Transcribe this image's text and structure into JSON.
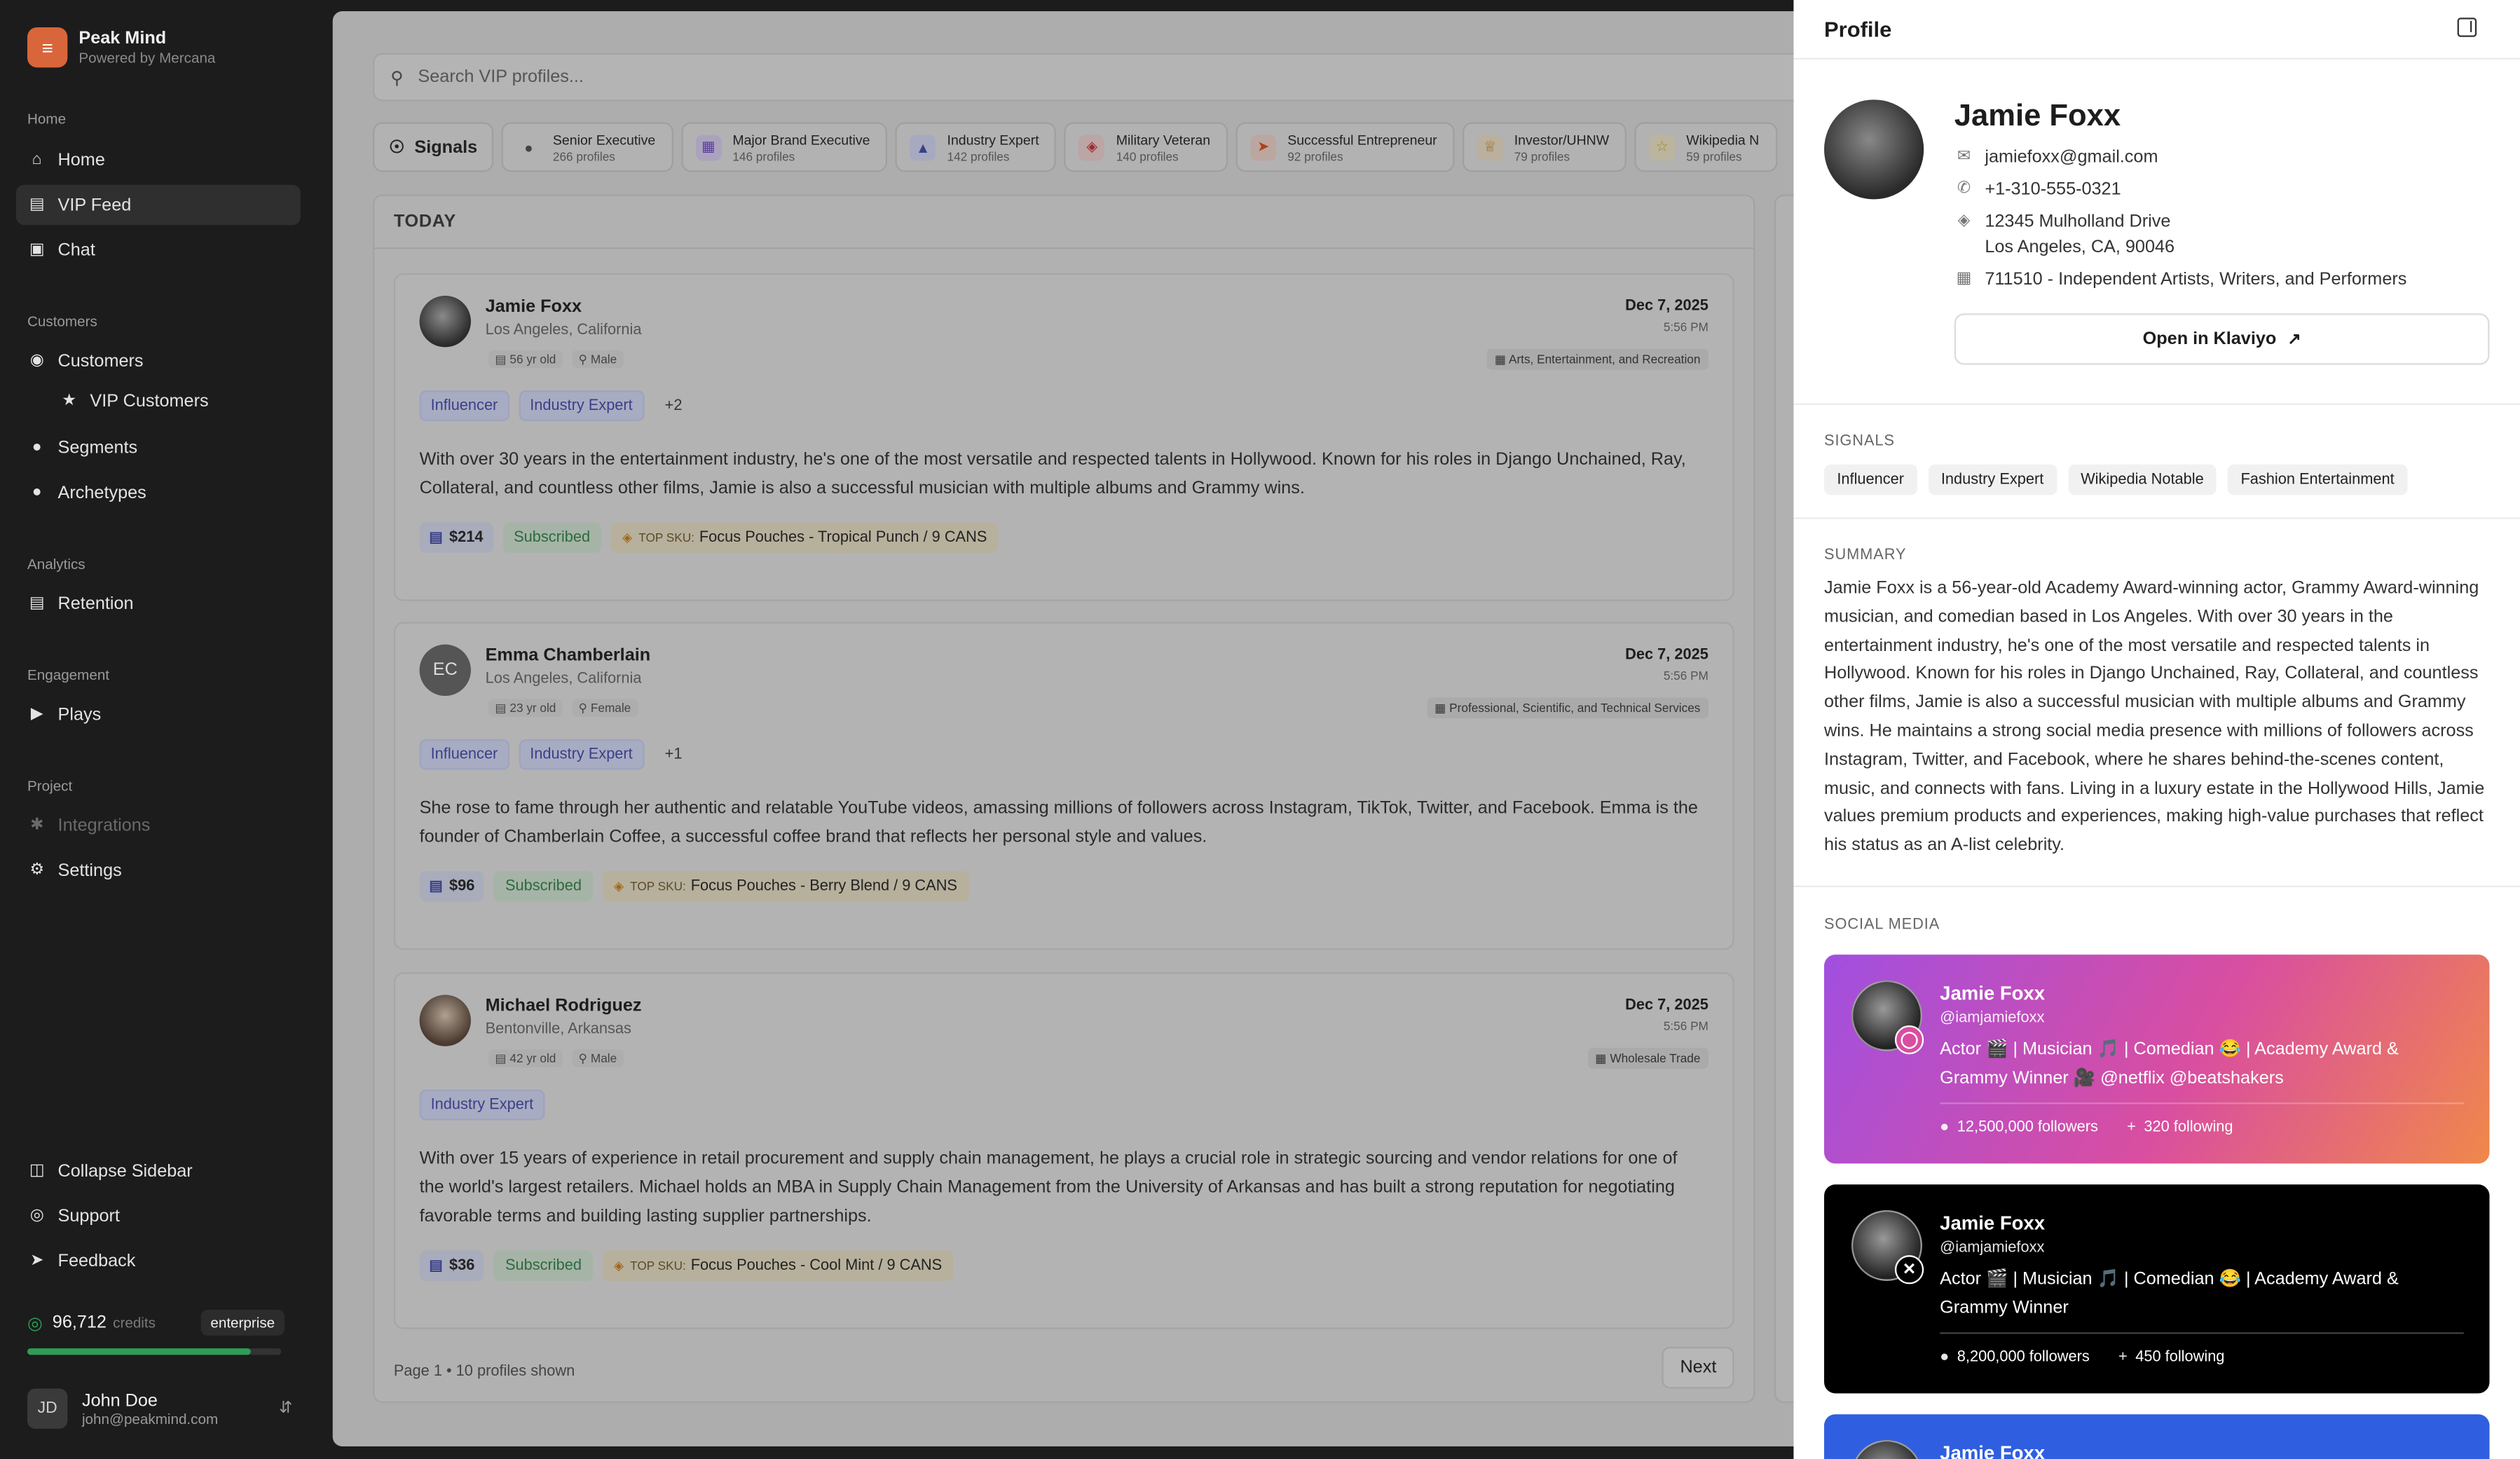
{
  "brand": {
    "name": "Peak Mind",
    "sub": "Powered by Mercana"
  },
  "nav": {
    "home_section": "Home",
    "home": "Home",
    "vip_feed": "VIP Feed",
    "chat": "Chat",
    "customers_section": "Customers",
    "customers": "Customers",
    "vip_customers": "VIP Customers",
    "segments": "Segments",
    "archetypes": "Archetypes",
    "analytics_section": "Analytics",
    "retention": "Retention",
    "engagement_section": "Engagement",
    "plays": "Plays",
    "project_section": "Project",
    "integrations": "Integrations",
    "settings": "Settings",
    "collapse": "Collapse Sidebar",
    "support": "Support",
    "feedback": "Feedback"
  },
  "credits": {
    "value": "96,712",
    "label": "credits",
    "plan": "enterprise",
    "fill_fraction": 0.88
  },
  "user": {
    "initials": "JD",
    "name": "John Doe",
    "email": "john@peakmind.com"
  },
  "search": {
    "placeholder": "Search VIP profiles..."
  },
  "signals_label": "Signals",
  "chips": [
    {
      "title": "Senior Executive",
      "sub": "266 profiles"
    },
    {
      "title": "Major Brand Executive",
      "sub": "146 profiles"
    },
    {
      "title": "Industry Expert",
      "sub": "142 profiles"
    },
    {
      "title": "Military Veteran",
      "sub": "140 profiles"
    },
    {
      "title": "Successful Entrepreneur",
      "sub": "92 profiles"
    },
    {
      "title": "Investor/UHNW",
      "sub": "79 profiles"
    },
    {
      "title": "Wikipedia N",
      "sub": "59 profiles"
    }
  ],
  "feed": {
    "heading": "TODAY",
    "cards": [
      {
        "initials": "",
        "name": "Jamie Foxx",
        "location": "Los Angeles, California",
        "age": "56 yr old",
        "gender": "Male",
        "date": "Dec 7, 2025",
        "time": "5:56 PM",
        "industry": "Arts, Entertainment, and Recreation",
        "tags": [
          "Influencer",
          "Industry Expert"
        ],
        "more": "+2",
        "desc": "With over 30 years in the entertainment industry, he's one of the most versatile and respected talents in Hollywood. Known for his roles in Django Unchained, Ray, Collateral, and countless other films, Jamie is also a successful musician with multiple albums and Grammy wins.",
        "price": "$214",
        "status": "Subscribed",
        "sku_label": "TOP SKU:",
        "sku": "Focus Pouches - Tropical Punch / 9 CANS"
      },
      {
        "initials": "EC",
        "name": "Emma Chamberlain",
        "location": "Los Angeles, California",
        "age": "23 yr old",
        "gender": "Female",
        "date": "Dec 7, 2025",
        "time": "5:56 PM",
        "industry": "Professional, Scientific, and Technical Services",
        "tags": [
          "Influencer",
          "Industry Expert"
        ],
        "more": "+1",
        "desc": "She rose to fame through her authentic and relatable YouTube videos, amassing millions of followers across Instagram, TikTok, Twitter, and Facebook. Emma is the founder of Chamberlain Coffee, a successful coffee brand that reflects her personal style and values.",
        "price": "$96",
        "status": "Subscribed",
        "sku_label": "TOP SKU:",
        "sku": "Focus Pouches - Berry Blend / 9 CANS"
      },
      {
        "initials": "",
        "name": "Michael Rodriguez",
        "location": "Bentonville, Arkansas",
        "age": "42 yr old",
        "gender": "Male",
        "date": "Dec 7, 2025",
        "time": "5:56 PM",
        "industry": "Wholesale Trade",
        "tags": [
          "Industry Expert"
        ],
        "more": "",
        "desc": "With over 15 years of experience in retail procurement and supply chain management, he plays a crucial role in strategic sourcing and vendor relations for one of the world's largest retailers. Michael holds an MBA in Supply Chain Management from the University of Arkansas and has built a strong reputation for negotiating favorable terms and building lasting supplier partnerships.",
        "price": "$36",
        "status": "Subscribed",
        "sku_label": "TOP SKU:",
        "sku": "Focus Pouches - Cool Mint / 9 CANS"
      }
    ],
    "pager": "Page 1 • 10 profiles shown",
    "next": "Next"
  },
  "profile": {
    "title": "Profile",
    "name": "Jamie Foxx",
    "email": "jamiefoxx@gmail.com",
    "phone": "+1-310-555-0321",
    "address1": "12345 Mulholland Drive",
    "address2": "Los Angeles, CA, 90046",
    "naics": "711510 - Independent Artists, Writers, and Performers",
    "klaviyo": "Open in Klaviyo",
    "signals_label": "SIGNALS",
    "signals": [
      "Influencer",
      "Industry Expert",
      "Wikipedia Notable",
      "Fashion Entertainment"
    ],
    "summary_label": "SUMMARY",
    "summary": "Jamie Foxx is a 56-year-old Academy Award-winning actor, Grammy Award-winning musician, and comedian based in Los Angeles. With over 30 years in the entertainment industry, he's one of the most versatile and respected talents in Hollywood. Known for his roles in Django Unchained, Ray, Collateral, and countless other films, Jamie is also a successful musician with multiple albums and Grammy wins. He maintains a strong social media presence with millions of followers across Instagram, Twitter, and Facebook, where he shares behind-the-scenes content, music, and connects with fans. Living in a luxury estate in the Hollywood Hills, Jamie values premium products and experiences, making high-value purchases that reflect his status as an A-list celebrity.",
    "social_label": "SOCIAL MEDIA",
    "social": [
      {
        "name": "Jamie Foxx",
        "handle": "@iamjamiefoxx",
        "bio": "Actor 🎬 | Musician 🎵 | Comedian 😂 | Academy Award & Grammy Winner 🎥 @netflix @beatshakers",
        "followers": "12,500,000 followers",
        "following": "320 following"
      },
      {
        "name": "Jamie Foxx",
        "handle": "@iamjamiefoxx",
        "bio": "Actor 🎬 | Musician 🎵 | Comedian 😂 | Academy Award & Grammy Winner",
        "followers": "8,200,000 followers",
        "following": "450 following"
      },
      {
        "name": "Jamie Foxx"
      }
    ]
  }
}
